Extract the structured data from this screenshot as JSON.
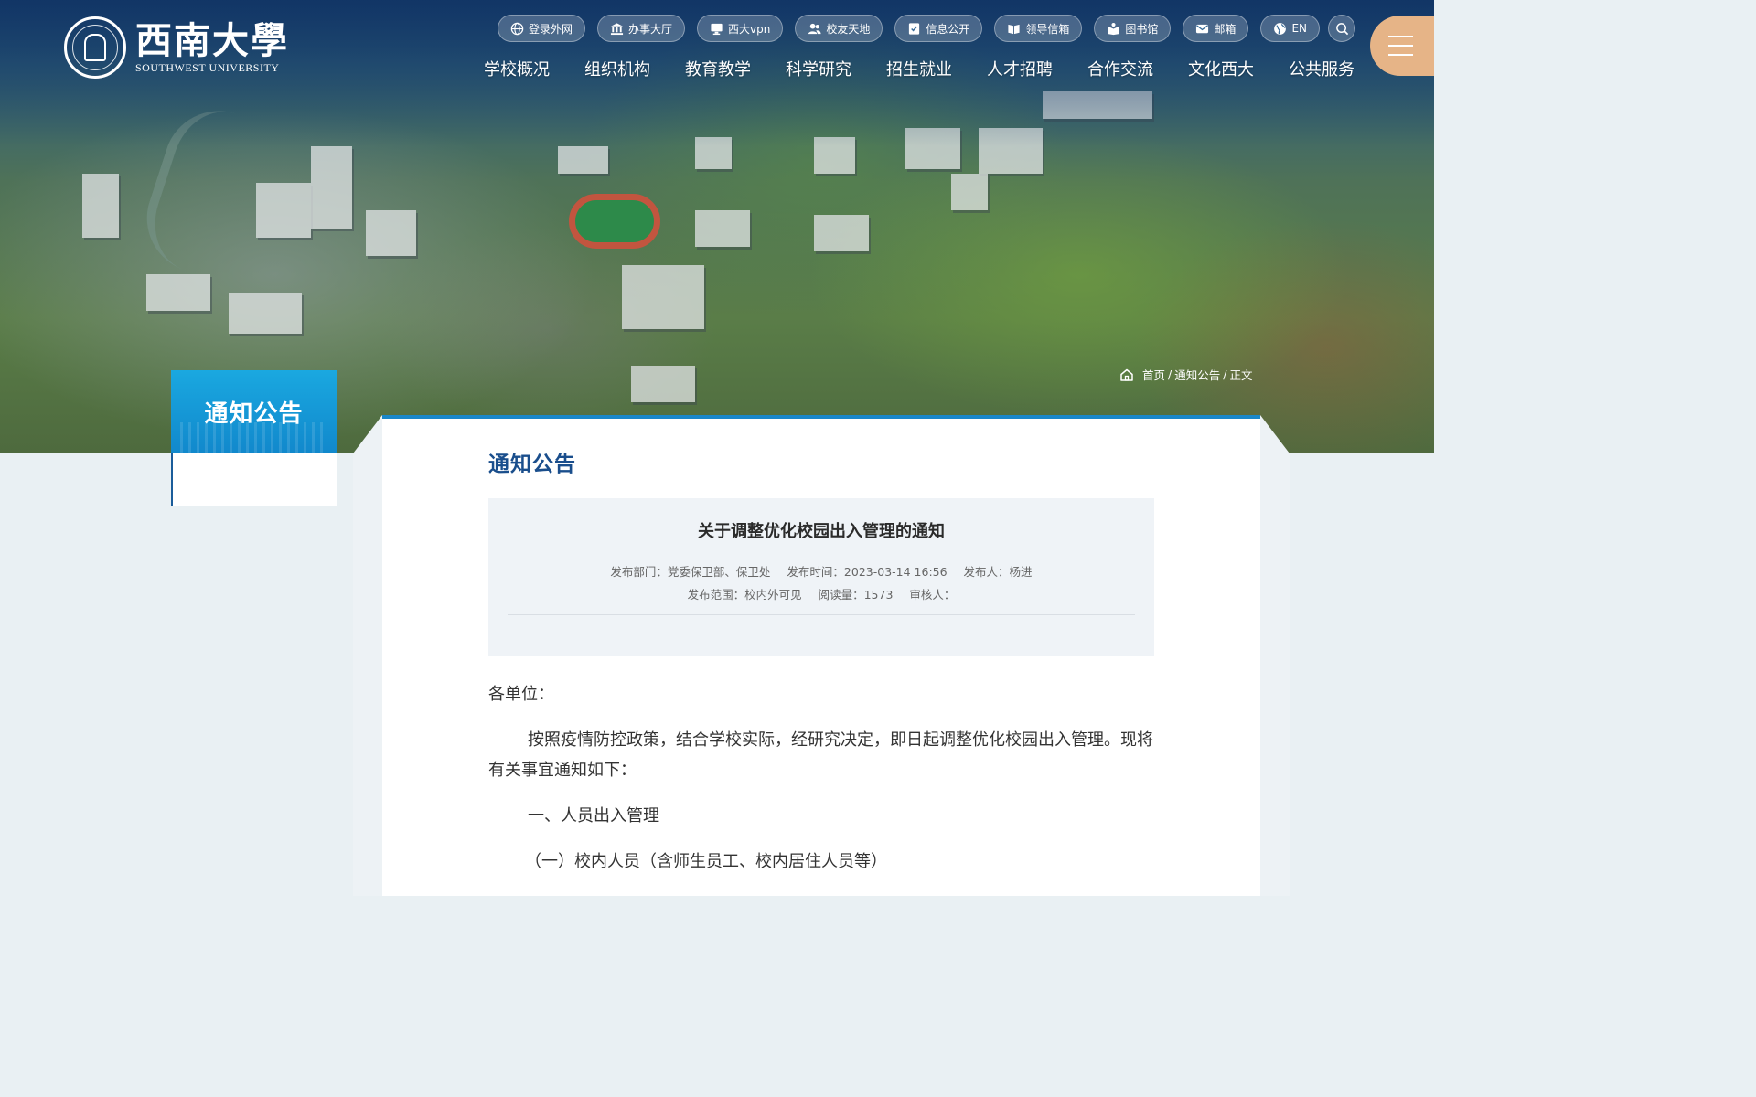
{
  "header": {
    "logo_cn": "西南大學",
    "logo_en": "SOUTHWEST   UNIVERSITY"
  },
  "quicklinks": [
    {
      "label": "登录外网",
      "icon": "globe-icon"
    },
    {
      "label": "办事大厅",
      "icon": "building-icon"
    },
    {
      "label": "西大vpn",
      "icon": "monitor-icon"
    },
    {
      "label": "校友天地",
      "icon": "users-icon"
    },
    {
      "label": "信息公开",
      "icon": "document-icon"
    },
    {
      "label": "领导信箱",
      "icon": "book-icon"
    },
    {
      "label": "图书馆",
      "icon": "library-icon"
    },
    {
      "label": "邮箱",
      "icon": "mail-icon"
    },
    {
      "label": "EN",
      "icon": "globe-icon"
    }
  ],
  "nav": [
    "学校概况",
    "组织机构",
    "教育教学",
    "科学研究",
    "招生就业",
    "人才招聘",
    "合作交流",
    "文化西大",
    "公共服务"
  ],
  "breadcrumb": {
    "home": "首页",
    "section": "通知公告",
    "current": "正文",
    "separator": "/"
  },
  "sidebar": {
    "title": "通知公告"
  },
  "section_title": "通知公告",
  "article": {
    "title": "关于调整优化校园出入管理的通知",
    "meta": {
      "department": "发布部门：党委保卫部、保卫处",
      "time": "发布时间：2023-03-14 16:56",
      "publisher": "发布人：杨进",
      "scope": "发布范围：校内外可见",
      "views": "阅读量：1573",
      "reviewer": "审核人："
    },
    "body": {
      "greeting": "各单位：",
      "p1": "按照疫情防控政策，结合学校实际，经研究决定，即日起调整优化校园出入管理。现将有关事宜通知如下：",
      "h1": "一、人员出入管理",
      "h2": "（一）校内人员（含师生员工、校内居住人员等）"
    }
  },
  "colors": {
    "accent_blue": "#1a87c9",
    "title_blue": "#1a4e8c",
    "menu_button": "#e6b487"
  }
}
